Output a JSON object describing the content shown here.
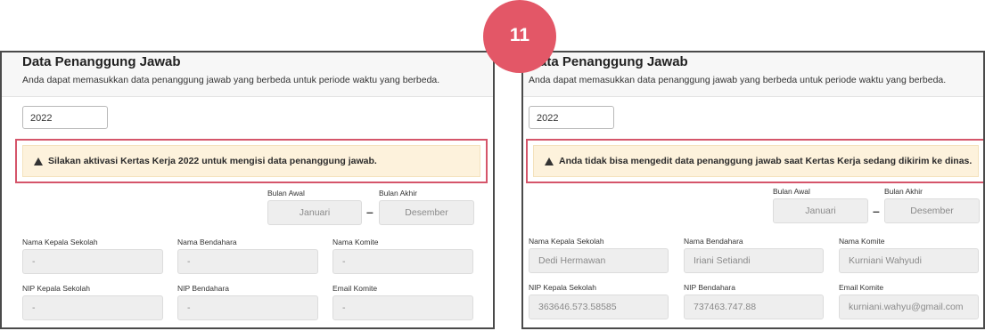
{
  "step_badge": "11",
  "left": {
    "title": "Data Penanggung Jawab",
    "description": "Anda dapat memasukkan data penanggung jawab yang berbeda untuk periode waktu yang berbeda.",
    "year": "2022",
    "alert": "Silakan aktivasi Kertas Kerja 2022 untuk mengisi data penanggung jawab.",
    "bulan_awal_label": "Bulan Awal",
    "bulan_awal_value": "Januari",
    "bulan_akhir_label": "Bulan Akhir",
    "bulan_akhir_value": "Desember",
    "separator": "–",
    "fields": [
      {
        "label": "Nama Kepala Sekolah",
        "value": "-"
      },
      {
        "label": "Nama Bendahara",
        "value": "-"
      },
      {
        "label": "Nama Komite",
        "value": "-"
      },
      {
        "label": "NIP Kepala Sekolah",
        "value": "-"
      },
      {
        "label": "NIP Bendahara",
        "value": "-"
      },
      {
        "label": "Email Komite",
        "value": "-"
      }
    ]
  },
  "right": {
    "title": "ata Penanggung Jawab",
    "description": "Anda dapat memasukkan data penanggung jawab yang berbeda untuk periode waktu yang berbeda.",
    "year": "2022",
    "alert": "Anda tidak bisa mengedit data penanggung jawab saat Kertas Kerja sedang dikirim ke dinas.",
    "bulan_awal_label": "Bulan Awal",
    "bulan_awal_value": "Januari",
    "bulan_akhir_label": "Bulan Akhir",
    "bulan_akhir_value": "Desember",
    "separator": "–",
    "fields": [
      {
        "label": "Nama Kepala Sekolah",
        "value": "Dedi Hermawan"
      },
      {
        "label": "Nama Bendahara",
        "value": "Iriani Setiandi"
      },
      {
        "label": "Nama Komite",
        "value": "Kurniani Wahyudi"
      },
      {
        "label": "NIP Kepala Sekolah",
        "value": "363646.573.58585"
      },
      {
        "label": "NIP Bendahara",
        "value": "737463.747.88"
      },
      {
        "label": "Email Komite",
        "value": "kurniani.wahyu@gmail.com"
      }
    ]
  },
  "colors": {
    "badge": "#e35767",
    "alert_outline": "#d5556a",
    "alert_background": "#fdf2dc",
    "field_background": "#eeeeee"
  }
}
